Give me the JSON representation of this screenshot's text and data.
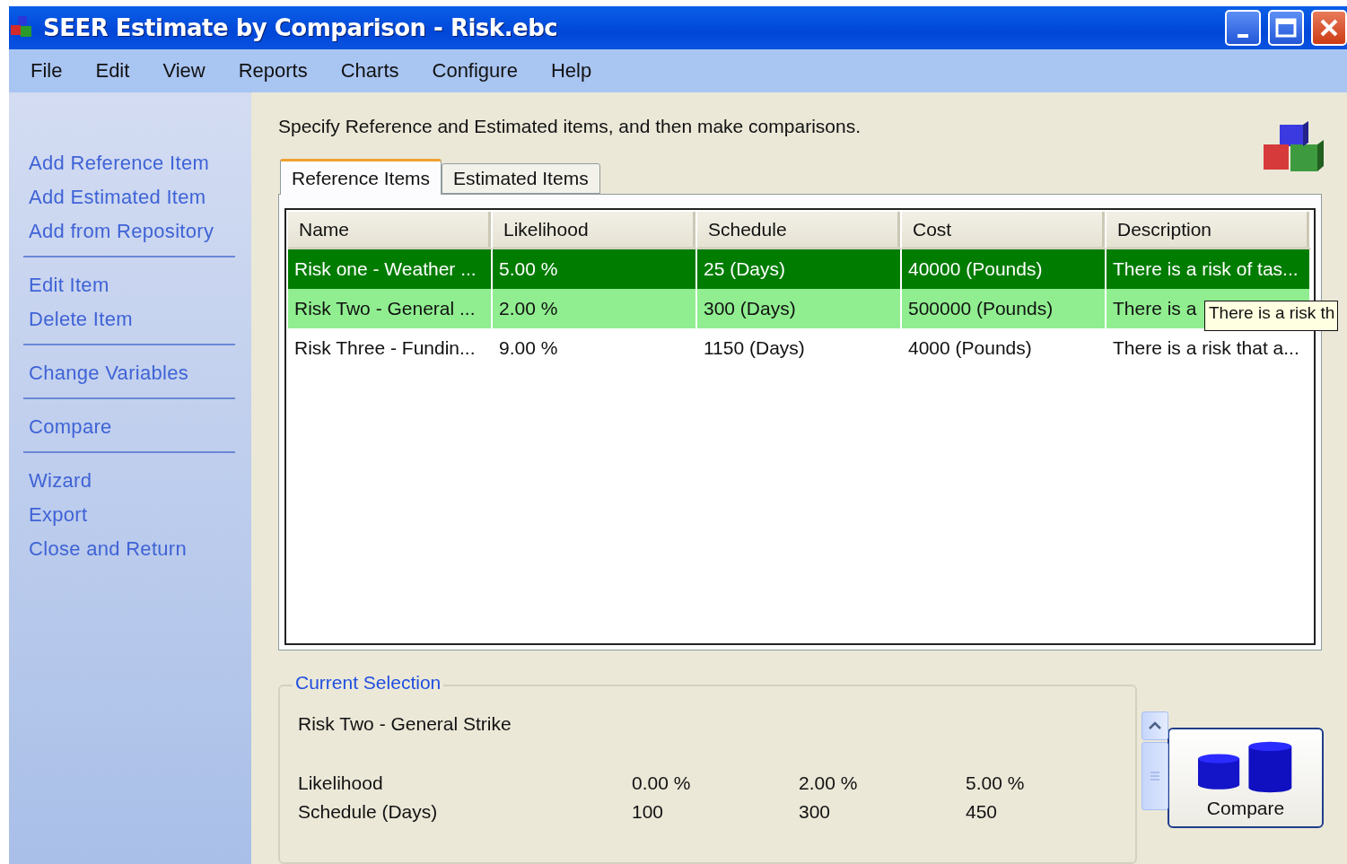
{
  "window": {
    "title": "SEER Estimate by Comparison - Risk.ebc"
  },
  "menu": [
    "File",
    "Edit",
    "View",
    "Reports",
    "Charts",
    "Configure",
    "Help"
  ],
  "sidebar": {
    "groups": [
      [
        "Add Reference Item",
        "Add Estimated Item",
        "Add from Repository"
      ],
      [
        "Edit Item",
        "Delete Item"
      ],
      [
        "Change Variables"
      ],
      [
        "Compare"
      ],
      [
        "Wizard",
        "Export",
        "Close and Return"
      ]
    ]
  },
  "instruction": "Specify Reference and Estimated items, and then make comparisons.",
  "tabs": [
    {
      "label": "Reference Items",
      "selected": true
    },
    {
      "label": "Estimated Items",
      "selected": false
    }
  ],
  "table": {
    "columns": [
      "Name",
      "Likelihood",
      "Schedule",
      "Cost",
      "Description"
    ],
    "rows": [
      {
        "selected": true,
        "hover": false,
        "cells": [
          "Risk one - Weather ...",
          "5.00 %",
          "25 (Days)",
          "40000 (Pounds)",
          "There is a risk of tas..."
        ]
      },
      {
        "selected": false,
        "hover": true,
        "cells": [
          "Risk Two - General ...",
          "2.00 %",
          "300 (Days)",
          "500000 (Pounds)",
          "There is a"
        ]
      },
      {
        "selected": false,
        "hover": false,
        "cells": [
          "Risk Three - Fundin...",
          "9.00 %",
          "1150 (Days)",
          "4000 (Pounds)",
          "There is a risk that a..."
        ]
      }
    ]
  },
  "tooltip": "There is a risk th",
  "current_selection": {
    "title": "Current Selection",
    "name": "Risk Two - General Strike",
    "rows": [
      {
        "label": "Likelihood",
        "values": [
          "0.00 %",
          "2.00 %",
          "5.00 %"
        ]
      },
      {
        "label": "Schedule (Days)",
        "values": [
          "100",
          "300",
          "450"
        ]
      }
    ]
  },
  "compare_button": "Compare"
}
